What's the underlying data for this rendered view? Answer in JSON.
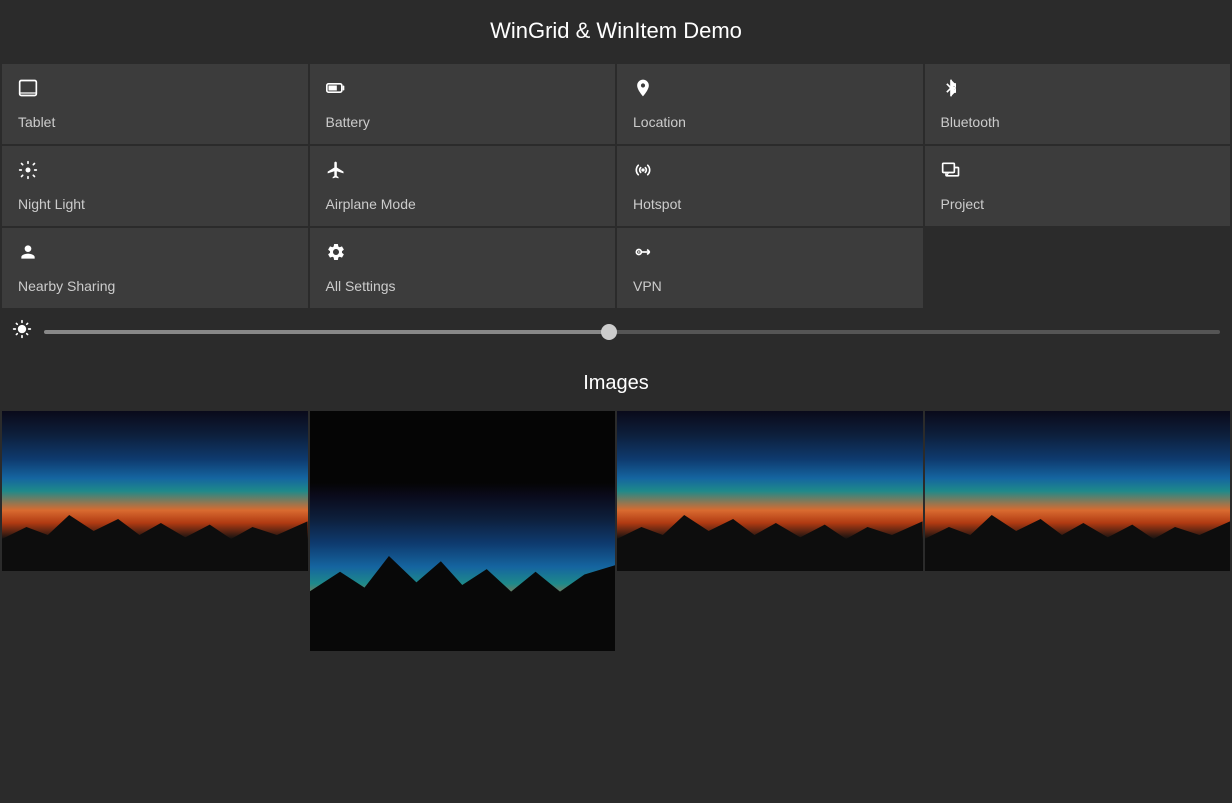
{
  "page": {
    "title": "WinGrid & WinItem Demo"
  },
  "grid": {
    "items": [
      {
        "id": "tablet",
        "icon": "tablet-icon",
        "icon_unicode": "⬜",
        "label": "Tablet"
      },
      {
        "id": "battery",
        "icon": "battery-icon",
        "icon_unicode": "🔋",
        "label": "Battery"
      },
      {
        "id": "location",
        "icon": "location-icon",
        "icon_unicode": "📍",
        "label": "Location"
      },
      {
        "id": "bluetooth",
        "icon": "bluetooth-icon",
        "icon_unicode": "✱",
        "label": "Bluetooth"
      },
      {
        "id": "night-light",
        "icon": "settings-icon",
        "icon_unicode": "⚙",
        "label": "Night Light"
      },
      {
        "id": "airplane-mode",
        "icon": "airplane-icon",
        "icon_unicode": "✈",
        "label": "Airplane Mode"
      },
      {
        "id": "hotspot",
        "icon": "hotspot-icon",
        "icon_unicode": "◎",
        "label": "Hotspot"
      },
      {
        "id": "project",
        "icon": "project-icon",
        "icon_unicode": "⬛",
        "label": "Project"
      },
      {
        "id": "nearby-sharing",
        "icon": "nearby-icon",
        "icon_unicode": "👤",
        "label": "Nearby Sharing"
      },
      {
        "id": "all-settings",
        "icon": "settings-icon",
        "icon_unicode": "⚙",
        "label": "All Settings"
      },
      {
        "id": "vpn",
        "icon": "vpn-icon",
        "icon_unicode": "🔑",
        "label": "VPN"
      }
    ]
  },
  "brightness": {
    "icon": "brightness-icon",
    "value": 48,
    "min": 0,
    "max": 100
  },
  "images_section": {
    "title": "Images",
    "count": 4
  }
}
